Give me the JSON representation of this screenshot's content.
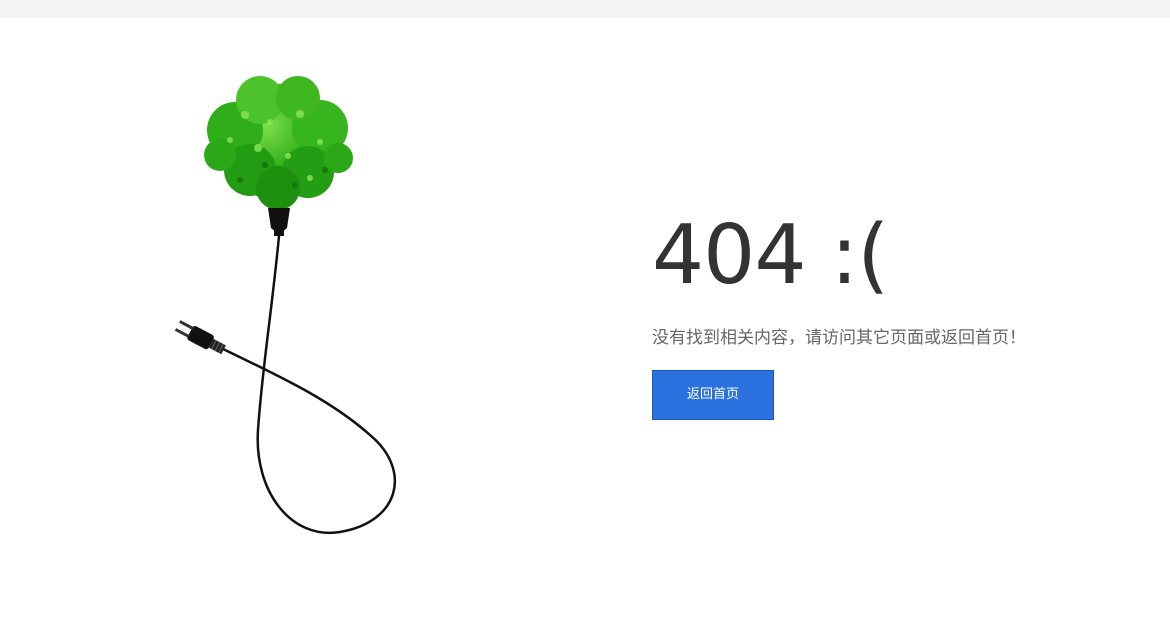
{
  "error": {
    "code_text": "404 :(",
    "message": "没有找到相关内容，请访问其它页面或返回首页！",
    "home_button_label": "返回首页"
  },
  "illustration": {
    "icons": [
      "tree-icon",
      "power-plug-icon"
    ]
  },
  "colors": {
    "page_background": "#ffffff",
    "top_bar": "#f4f4f4",
    "heading_text": "#333333",
    "message_text": "#666666",
    "button_background": "#2b71e0",
    "button_text": "#ffffff",
    "foliage": "#3fb51e"
  }
}
